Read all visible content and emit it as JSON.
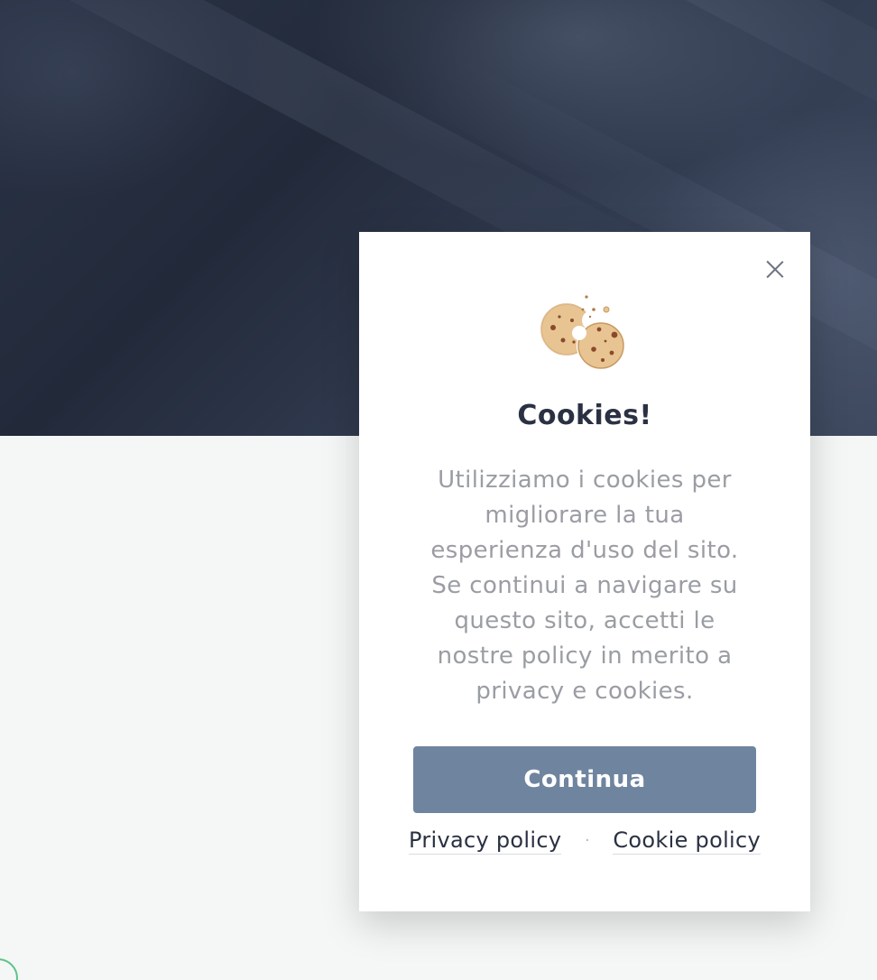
{
  "modal": {
    "close_icon": "close-icon",
    "illustration_icon": "cookie-icon",
    "title": "Cookies!",
    "message": "Utilizziamo i cookies per migliorare la tua esperienza d'uso del sito. Se continui a navigare su questo sito, accetti le nostre policy in merito a privacy e cookies.",
    "continue_label": "Continua",
    "privacy_link": "Privacy policy",
    "separator": "·",
    "cookie_link": "Cookie policy"
  },
  "colors": {
    "button": "#6f849f",
    "title": "#2a3142",
    "body_text": "#9a9da3",
    "hero_dark": "#222a3a",
    "accent_ring": "#5cc28a"
  }
}
